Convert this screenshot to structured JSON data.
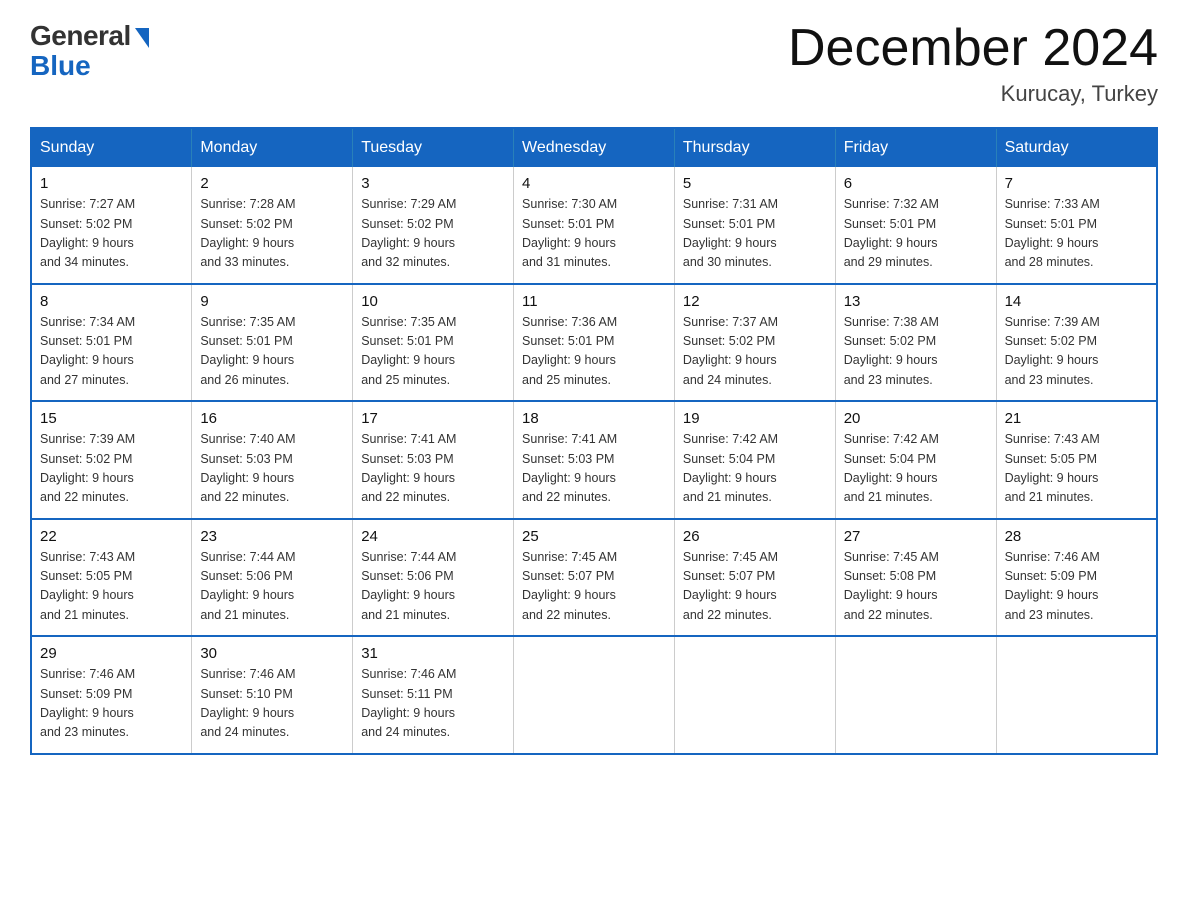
{
  "header": {
    "logo_general": "General",
    "logo_blue": "Blue",
    "title": "December 2024",
    "location": "Kurucay, Turkey"
  },
  "calendar": {
    "days_of_week": [
      "Sunday",
      "Monday",
      "Tuesday",
      "Wednesday",
      "Thursday",
      "Friday",
      "Saturday"
    ],
    "weeks": [
      [
        {
          "day": "1",
          "sunrise": "7:27 AM",
          "sunset": "5:02 PM",
          "daylight": "9 hours and 34 minutes."
        },
        {
          "day": "2",
          "sunrise": "7:28 AM",
          "sunset": "5:02 PM",
          "daylight": "9 hours and 33 minutes."
        },
        {
          "day": "3",
          "sunrise": "7:29 AM",
          "sunset": "5:02 PM",
          "daylight": "9 hours and 32 minutes."
        },
        {
          "day": "4",
          "sunrise": "7:30 AM",
          "sunset": "5:01 PM",
          "daylight": "9 hours and 31 minutes."
        },
        {
          "day": "5",
          "sunrise": "7:31 AM",
          "sunset": "5:01 PM",
          "daylight": "9 hours and 30 minutes."
        },
        {
          "day": "6",
          "sunrise": "7:32 AM",
          "sunset": "5:01 PM",
          "daylight": "9 hours and 29 minutes."
        },
        {
          "day": "7",
          "sunrise": "7:33 AM",
          "sunset": "5:01 PM",
          "daylight": "9 hours and 28 minutes."
        }
      ],
      [
        {
          "day": "8",
          "sunrise": "7:34 AM",
          "sunset": "5:01 PM",
          "daylight": "9 hours and 27 minutes."
        },
        {
          "day": "9",
          "sunrise": "7:35 AM",
          "sunset": "5:01 PM",
          "daylight": "9 hours and 26 minutes."
        },
        {
          "day": "10",
          "sunrise": "7:35 AM",
          "sunset": "5:01 PM",
          "daylight": "9 hours and 25 minutes."
        },
        {
          "day": "11",
          "sunrise": "7:36 AM",
          "sunset": "5:01 PM",
          "daylight": "9 hours and 25 minutes."
        },
        {
          "day": "12",
          "sunrise": "7:37 AM",
          "sunset": "5:02 PM",
          "daylight": "9 hours and 24 minutes."
        },
        {
          "day": "13",
          "sunrise": "7:38 AM",
          "sunset": "5:02 PM",
          "daylight": "9 hours and 23 minutes."
        },
        {
          "day": "14",
          "sunrise": "7:39 AM",
          "sunset": "5:02 PM",
          "daylight": "9 hours and 23 minutes."
        }
      ],
      [
        {
          "day": "15",
          "sunrise": "7:39 AM",
          "sunset": "5:02 PM",
          "daylight": "9 hours and 22 minutes."
        },
        {
          "day": "16",
          "sunrise": "7:40 AM",
          "sunset": "5:03 PM",
          "daylight": "9 hours and 22 minutes."
        },
        {
          "day": "17",
          "sunrise": "7:41 AM",
          "sunset": "5:03 PM",
          "daylight": "9 hours and 22 minutes."
        },
        {
          "day": "18",
          "sunrise": "7:41 AM",
          "sunset": "5:03 PM",
          "daylight": "9 hours and 22 minutes."
        },
        {
          "day": "19",
          "sunrise": "7:42 AM",
          "sunset": "5:04 PM",
          "daylight": "9 hours and 21 minutes."
        },
        {
          "day": "20",
          "sunrise": "7:42 AM",
          "sunset": "5:04 PM",
          "daylight": "9 hours and 21 minutes."
        },
        {
          "day": "21",
          "sunrise": "7:43 AM",
          "sunset": "5:05 PM",
          "daylight": "9 hours and 21 minutes."
        }
      ],
      [
        {
          "day": "22",
          "sunrise": "7:43 AM",
          "sunset": "5:05 PM",
          "daylight": "9 hours and 21 minutes."
        },
        {
          "day": "23",
          "sunrise": "7:44 AM",
          "sunset": "5:06 PM",
          "daylight": "9 hours and 21 minutes."
        },
        {
          "day": "24",
          "sunrise": "7:44 AM",
          "sunset": "5:06 PM",
          "daylight": "9 hours and 21 minutes."
        },
        {
          "day": "25",
          "sunrise": "7:45 AM",
          "sunset": "5:07 PM",
          "daylight": "9 hours and 22 minutes."
        },
        {
          "day": "26",
          "sunrise": "7:45 AM",
          "sunset": "5:07 PM",
          "daylight": "9 hours and 22 minutes."
        },
        {
          "day": "27",
          "sunrise": "7:45 AM",
          "sunset": "5:08 PM",
          "daylight": "9 hours and 22 minutes."
        },
        {
          "day": "28",
          "sunrise": "7:46 AM",
          "sunset": "5:09 PM",
          "daylight": "9 hours and 23 minutes."
        }
      ],
      [
        {
          "day": "29",
          "sunrise": "7:46 AM",
          "sunset": "5:09 PM",
          "daylight": "9 hours and 23 minutes."
        },
        {
          "day": "30",
          "sunrise": "7:46 AM",
          "sunset": "5:10 PM",
          "daylight": "9 hours and 24 minutes."
        },
        {
          "day": "31",
          "sunrise": "7:46 AM",
          "sunset": "5:11 PM",
          "daylight": "9 hours and 24 minutes."
        },
        null,
        null,
        null,
        null
      ]
    ]
  }
}
